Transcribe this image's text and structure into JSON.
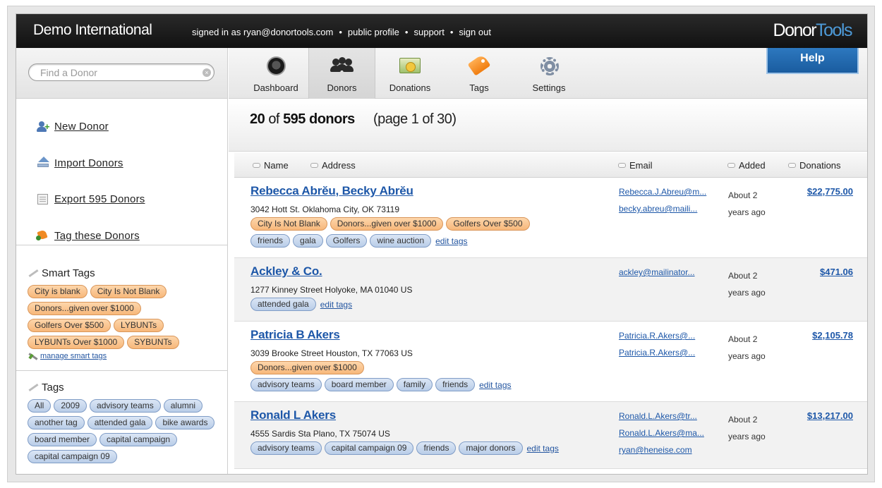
{
  "header": {
    "org_name": "Demo International",
    "signed_in": "signed in as ryan@donortools.com",
    "links": [
      "public profile",
      "support",
      "sign out"
    ],
    "logo_part1": "Donor",
    "logo_part2": "Tools"
  },
  "sidebar": {
    "search_placeholder": "Find a Donor",
    "actions": [
      {
        "label": "New Donor",
        "icon": "new-donor-icon"
      },
      {
        "label": "Import Donors",
        "icon": "import-icon"
      },
      {
        "label": "Export 595 Donors",
        "icon": "export-icon"
      },
      {
        "label": "Tag these Donors",
        "icon": "tag-icon"
      }
    ],
    "smart_tags": {
      "title": "Smart Tags",
      "tags": [
        "City is blank",
        "City Is Not Blank",
        "Donors...given over $1000",
        "Golfers Over $500",
        "LYBUNTs",
        "LYBUNTs Over $1000",
        "SYBUNTs"
      ],
      "manage_link": "manage smart tags"
    },
    "tags": {
      "title": "Tags",
      "tags": [
        "All",
        "2009",
        "advisory teams",
        "alumni",
        "another tag",
        "attended gala",
        "bike awards",
        "board member",
        "capital campaign",
        "capital campaign 09"
      ]
    }
  },
  "nav": {
    "items": [
      {
        "label": "Dashboard",
        "icon": "dashboard-icon"
      },
      {
        "label": "Donors",
        "icon": "donors-icon"
      },
      {
        "label": "Donations",
        "icon": "donations-icon"
      },
      {
        "label": "Tags",
        "icon": "tags-icon"
      },
      {
        "label": "Settings",
        "icon": "settings-icon"
      }
    ],
    "active": "Donors",
    "help_label": "Help"
  },
  "summary": {
    "shown": "20",
    "of_word": "of",
    "total": "595 donors",
    "page_info": "(page 1 of 30)"
  },
  "table": {
    "columns": [
      "Name",
      "Address",
      "Email",
      "Added",
      "Donations"
    ],
    "edit_label": "edit tags",
    "rows": [
      {
        "name": "Rebecca Abrĕu, Becky Abrĕu",
        "address": "3042 Hott St. Oklahoma City, OK 73119",
        "smart_tags": [
          "City Is Not Blank",
          "Donors...given over $1000",
          "Golfers Over $500"
        ],
        "tags": [
          "friends",
          "gala",
          "Golfers",
          "wine auction"
        ],
        "emails": [
          "Rebecca.J.Abreu@m...",
          "becky.abreu@maili..."
        ],
        "added_line1": "About 2",
        "added_line2": "years ago",
        "amount": "$22,775.00"
      },
      {
        "name": "Ackley & Co.",
        "address": "1277 Kinney Street Holyoke, MA 01040 US",
        "smart_tags": [],
        "tags": [
          "attended gala"
        ],
        "emails": [
          "ackley@mailinator..."
        ],
        "added_line1": "About 2",
        "added_line2": "years ago",
        "amount": "$471.06"
      },
      {
        "name": "Patricia B Akers",
        "address": "3039 Brooke Street Houston, TX 77063 US",
        "smart_tags": [
          "Donors...given over $1000"
        ],
        "tags": [
          "advisory teams",
          "board member",
          "family",
          "friends"
        ],
        "emails": [
          "Patricia.R.Akers@...",
          "Patricia.R.Akers@..."
        ],
        "added_line1": "About 2",
        "added_line2": "years ago",
        "amount": "$2,105.78"
      },
      {
        "name": "Ronald L Akers",
        "address": "4555 Sardis Sta Plano, TX 75074 US",
        "smart_tags": [],
        "tags": [
          "advisory teams",
          "capital campaign 09",
          "friends",
          "major donors"
        ],
        "emails": [
          "Ronald.L.Akers@tr...",
          "Ronald.L.Akers@ma...",
          "ryan@heneise.com"
        ],
        "added_line1": "About 2",
        "added_line2": "years ago",
        "amount": "$13,217.00"
      }
    ]
  }
}
